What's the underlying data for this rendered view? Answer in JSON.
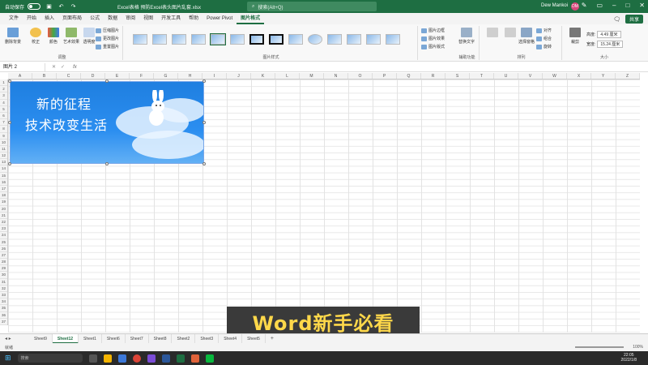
{
  "titlebar": {
    "autosave_label": "自动保存",
    "filename": "Excel表格 预防Excel表头图片乱套.xlsx",
    "search_placeholder": "搜索(Alt+Q)",
    "user_name": "Dew Mankoi",
    "avatar_initials": "DM"
  },
  "menu": {
    "tabs": [
      "文件",
      "开始",
      "插入",
      "页面布局",
      "公式",
      "数据",
      "审阅",
      "视图",
      "开发工具",
      "帮助",
      "Power Pivot",
      "图片格式"
    ],
    "active_tab": "图片格式",
    "share_label": "共享"
  },
  "ribbon": {
    "remove_bg_label": "删除背景",
    "correct_label": "校正",
    "color_label": "颜色",
    "art_label": "艺术效果",
    "transparency_label": "透明度",
    "compress_label": "压缩图片",
    "change_pic_label": "更改图片",
    "reset_pic_label": "重置图片",
    "adjust_group": "调整",
    "styles_group": "图片样式",
    "border_label": "图片边框",
    "effects_label": "图片效果",
    "layout_label": "图片版式",
    "alt_text_label": "替换文字",
    "accessibility_group": "辅助功能",
    "arrange_group": "排列",
    "selection_pane_label": "选择窗格",
    "align_label": "对齐",
    "group_label": "组合",
    "rotate_label": "旋转",
    "crop_label": "裁剪",
    "height_label": "高度:",
    "height_value": "4.49 厘米",
    "width_label": "宽度:",
    "width_value": "15.24 厘米",
    "size_group": "大小"
  },
  "formula": {
    "name_box": "图片 2",
    "fx": "fx"
  },
  "columns": [
    "A",
    "B",
    "C",
    "D",
    "E",
    "F",
    "G",
    "H",
    "I",
    "J",
    "K",
    "L",
    "M",
    "N",
    "O",
    "P",
    "Q",
    "R",
    "S",
    "T",
    "U",
    "V",
    "W",
    "X",
    "Y",
    "Z"
  ],
  "rows": [
    "1",
    "2",
    "3",
    "4",
    "5",
    "6",
    "7",
    "8",
    "9",
    "10",
    "11",
    "12",
    "13",
    "14",
    "15",
    "16",
    "17",
    "18",
    "19",
    "20",
    "21",
    "22",
    "23",
    "24",
    "25",
    "26",
    "27",
    "28",
    "29",
    "30",
    "31",
    "32",
    "33",
    "34",
    "35",
    "36",
    "37"
  ],
  "picture": {
    "line1": "新的征程",
    "line2": "技术改变生活"
  },
  "sheets": [
    "Sheet9",
    "Sheet12",
    "Sheet1",
    "Sheet6",
    "Sheet7",
    "Sheet8",
    "Sheet2",
    "Sheet3",
    "Sheet4",
    "Sheet5"
  ],
  "active_sheet": "Sheet12",
  "status": {
    "ready": "就绪",
    "zoom": "100%"
  },
  "taskbar": {
    "search_placeholder": "搜索",
    "time": "22:05",
    "date": "2022/1/8"
  },
  "caption": "Word新手必看",
  "colors": {
    "excel_green": "#1e6e42",
    "caption_text": "#ffd84a",
    "picture_blue": "#1f7fe0"
  }
}
